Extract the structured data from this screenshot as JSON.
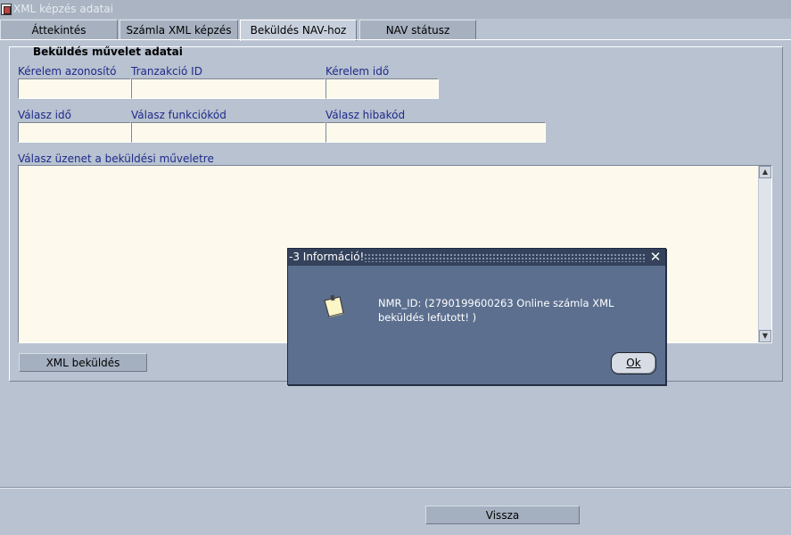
{
  "window": {
    "title": "XML képzés adatai"
  },
  "tabs": [
    {
      "label": "Áttekintés"
    },
    {
      "label": "Számla XML képzés"
    },
    {
      "label": "Beküldés NAV-hoz"
    },
    {
      "label": "NAV státusz"
    }
  ],
  "active_tab": "Beküldés NAV-hoz",
  "section": {
    "title": "Beküldés művelet adatai",
    "fields": {
      "request_id_label": "Kérelem azonosító",
      "transaction_id_label": "Tranzakció ID",
      "request_time_label": "Kérelem idő",
      "response_time_label": "Válasz idő",
      "response_function_code_label": "Válasz funkciókód",
      "response_error_code_label": "Válasz hibakód",
      "response_message_label": "Válasz üzenet a beküldési műveletre"
    },
    "values": {
      "request_id": "",
      "transaction_id": "",
      "request_time": "",
      "response_time": "",
      "response_function_code": "",
      "response_error_code": "",
      "response_message": ""
    },
    "send_button": "XML beküldés"
  },
  "footer": {
    "back_button": "Vissza"
  },
  "dialog": {
    "title": "-3 Információ!",
    "close_symbol": "✕",
    "message": "NMR_ID: (2790199600263 Online számla XML beküldés lefutott! )",
    "ok_button": "Ok",
    "icon": "note-icon"
  },
  "colors": {
    "background": "#b8c2d0",
    "field_bg": "#fdfaed",
    "label_blue": "#1f2a8a",
    "dialog_bg": "#5c6f8f",
    "dialog_title_bg": "#34425c"
  }
}
